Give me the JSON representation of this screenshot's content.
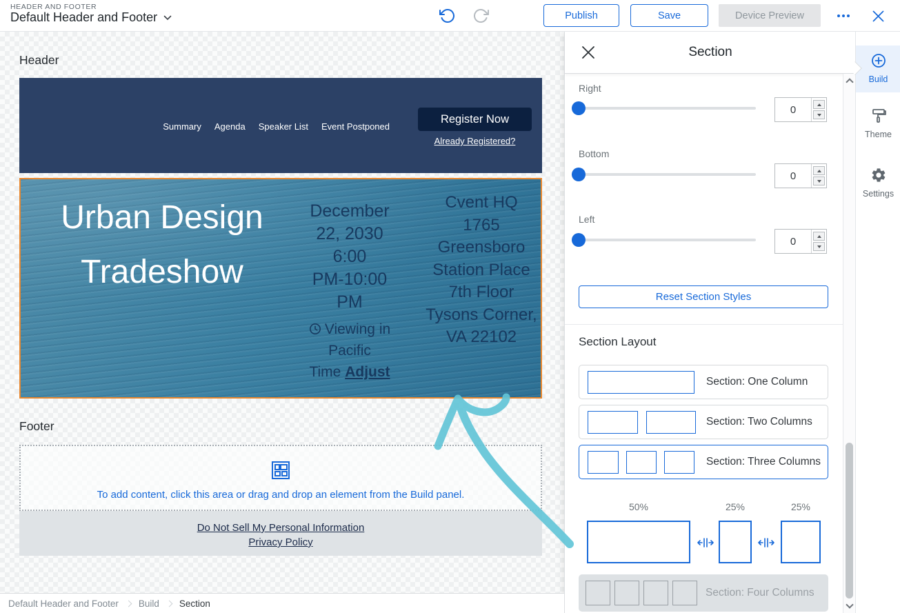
{
  "topbar": {
    "eyebrow": "HEADER AND FOOTER",
    "title": "Default Header and Footer",
    "publish_label": "Publish",
    "save_label": "Save",
    "device_preview_label": "Device Preview"
  },
  "canvas": {
    "header_label": "Header",
    "footer_label": "Footer",
    "nav_items": [
      "Summary",
      "Agenda",
      "Speaker List",
      "Event Postponed"
    ],
    "register_label": "Register Now",
    "already_registered_label": "Already Registered?",
    "hero": {
      "title_lines": [
        "Urban Design",
        "Tradeshow"
      ],
      "date_lines": [
        "December",
        "22, 2030",
        "6:00",
        "PM-10:00",
        "PM"
      ],
      "viewing_lines": [
        "Viewing in",
        "Pacific",
        "Time"
      ],
      "adjust_label": "Adjust",
      "location_lines": [
        "Cvent HQ",
        "1765",
        "Greensboro",
        "Station Place",
        "7th Floor",
        "Tysons Corner,",
        "VA 22102"
      ]
    },
    "placeholder_text": "To add content, click this area or drag and drop an element from the Build panel.",
    "footer_links": [
      "Do Not Sell My Personal Information",
      "Privacy Policy"
    ]
  },
  "panel": {
    "title": "Section",
    "sliders": [
      {
        "label": "Right",
        "value": "0"
      },
      {
        "label": "Bottom",
        "value": "0"
      },
      {
        "label": "Left",
        "value": "0"
      }
    ],
    "reset_label": "Reset Section Styles",
    "layout_heading": "Section Layout",
    "layout_options": [
      {
        "label": "Section: One Column",
        "selected": false
      },
      {
        "label": "Section: Two Columns",
        "selected": false
      },
      {
        "label": "Section: Three Columns",
        "selected": true
      },
      {
        "label": "Section: Four Columns",
        "selected": false,
        "disabled": true
      }
    ],
    "column_widths": [
      "50%",
      "25%",
      "25%"
    ]
  },
  "sidebar": {
    "items": [
      {
        "label": "Build",
        "active": true
      },
      {
        "label": "Theme",
        "active": false
      },
      {
        "label": "Settings",
        "active": false
      }
    ]
  },
  "breadcrumb": [
    "Default Header and Footer",
    "Build",
    "Section"
  ],
  "icons": {
    "undo-icon": "counter-clockwise arrow",
    "redo-icon": "clockwise arrow",
    "more-icon": "three dots",
    "close-icon": "x",
    "chevron-down-icon": "v",
    "clock-icon": "clock face",
    "layout-grid-icon": "blocks grid",
    "resize-handle-icon": "horizontal resize bars",
    "build-icon": "circled plus",
    "theme-icon": "paint roller",
    "settings-icon": "gear",
    "annotation-arrow": "hand-drawn teal arrow"
  },
  "colors": {
    "accent_blue": "#1769d9",
    "header_navy": "#2c4166",
    "register_navy": "#0c2040",
    "selection_orange": "#e8872e",
    "hero_text_navy": "#17395f",
    "annotation_teal": "#63c5d8",
    "disabled_gray": "#e4e5e7"
  }
}
